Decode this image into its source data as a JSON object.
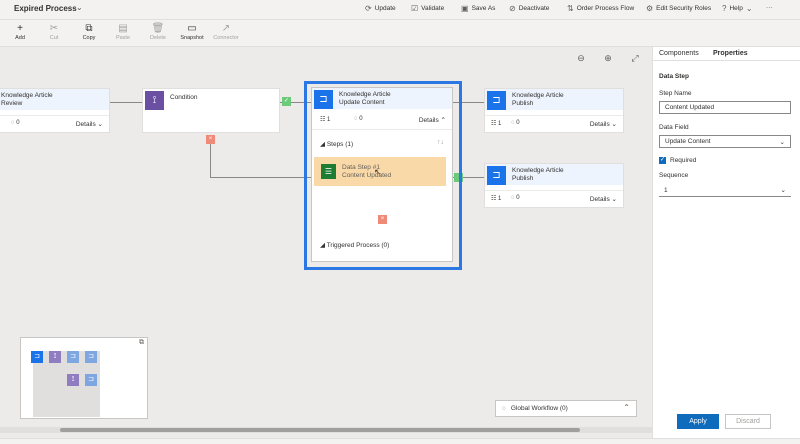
{
  "app_title": "Expired Process",
  "commands": [
    {
      "label": "Update",
      "icon": "update-icon"
    },
    {
      "label": "Validate",
      "icon": "validate-icon"
    },
    {
      "label": "Save As",
      "icon": "save-as-icon"
    },
    {
      "label": "Deactivate",
      "icon": "deactivate-icon"
    },
    {
      "label": "Order Process Flow",
      "icon": "order-icon"
    },
    {
      "label": "Edit Security Roles",
      "icon": "security-roles-icon"
    },
    {
      "label": "Help",
      "icon": "help-icon"
    },
    {
      "label": "···",
      "icon": "more-icon"
    }
  ],
  "toolbar": [
    {
      "label": "Add",
      "icon": "add-icon",
      "enabled": true
    },
    {
      "label": "Cut",
      "icon": "cut-icon",
      "enabled": false
    },
    {
      "label": "Copy",
      "icon": "copy-icon",
      "enabled": true
    },
    {
      "label": "Paste",
      "icon": "paste-icon",
      "enabled": false
    },
    {
      "label": "Delete",
      "icon": "delete-icon",
      "enabled": false
    },
    {
      "label": "Snapshot",
      "icon": "snapshot-icon",
      "enabled": true
    },
    {
      "label": "Connector",
      "icon": "connector-icon",
      "enabled": false
    }
  ],
  "canvas": {
    "stage_left": {
      "title_1": "Knowledge Article",
      "title_2": "Review",
      "count": "0",
      "details": "Details"
    },
    "condition": {
      "title": "Condition"
    },
    "selected": {
      "title_1": "Knowledge Article",
      "title_2": "Update Content",
      "fields": "1",
      "count": "0",
      "details": "Details",
      "steps_label": "Steps (1)",
      "data_step_1": "Data Step #1",
      "data_step_2": "Content Updated",
      "triggered_label": "Triggered Process (0)"
    },
    "publish_top": {
      "title_1": "Knowledge Article",
      "title_2": "Publish",
      "fields": "1",
      "count": "0",
      "details": "Details"
    },
    "publish_bottom": {
      "title_1": "Knowledge Article",
      "title_2": "Publish",
      "fields": "1",
      "count": "0",
      "details": "Details"
    },
    "global_workflow": "Global Workflow (0)"
  },
  "panel": {
    "tabs": [
      "Components",
      "Properties"
    ],
    "active_tab": "Properties",
    "section_title": "Data Step",
    "step_name_label": "Step Name",
    "step_name_value": "Content Updated",
    "data_field_label": "Data Field",
    "data_field_value": "Update Content",
    "required_label": "Required",
    "required_checked": true,
    "sequence_label": "Sequence",
    "sequence_value": "1",
    "apply_label": "Apply",
    "discard_label": "Discard"
  },
  "colors": {
    "accent": "#2b78e4",
    "stage_icon": "#1a73e8",
    "condition_icon": "#6b4fa2",
    "data_step_highlight": "#fad9a8",
    "apply_button": "#0f6cbd"
  }
}
